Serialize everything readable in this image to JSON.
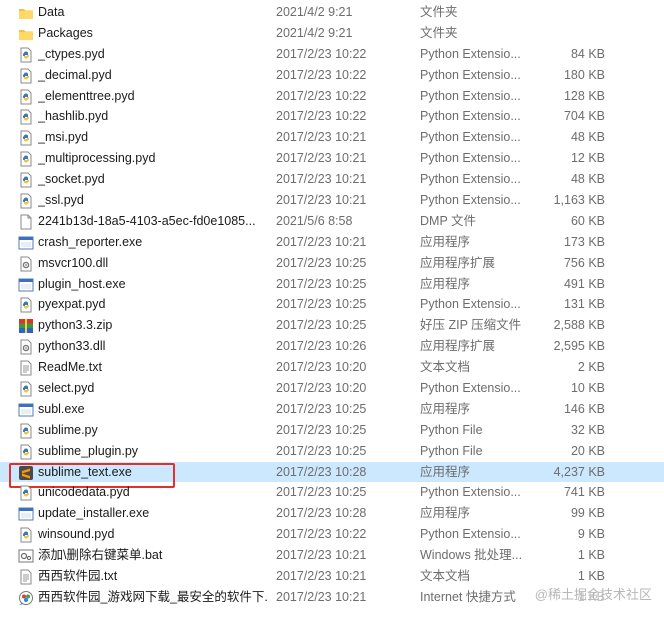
{
  "files": [
    {
      "name": "Data",
      "date": "2021/4/2 9:21",
      "type": "文件夹",
      "size": "",
      "icon": "folder-icon"
    },
    {
      "name": "Packages",
      "date": "2021/4/2 9:21",
      "type": "文件夹",
      "size": "",
      "icon": "folder-icon"
    },
    {
      "name": "_ctypes.pyd",
      "date": "2017/2/23 10:22",
      "type": "Python Extensio...",
      "size": "84 KB",
      "icon": "python-file-icon"
    },
    {
      "name": "_decimal.pyd",
      "date": "2017/2/23 10:22",
      "type": "Python Extensio...",
      "size": "180 KB",
      "icon": "python-file-icon"
    },
    {
      "name": "_elementtree.pyd",
      "date": "2017/2/23 10:22",
      "type": "Python Extensio...",
      "size": "128 KB",
      "icon": "python-file-icon"
    },
    {
      "name": "_hashlib.pyd",
      "date": "2017/2/23 10:22",
      "type": "Python Extensio...",
      "size": "704 KB",
      "icon": "python-file-icon"
    },
    {
      "name": "_msi.pyd",
      "date": "2017/2/23 10:21",
      "type": "Python Extensio...",
      "size": "48 KB",
      "icon": "python-file-icon"
    },
    {
      "name": "_multiprocessing.pyd",
      "date": "2017/2/23 10:21",
      "type": "Python Extensio...",
      "size": "12 KB",
      "icon": "python-file-icon"
    },
    {
      "name": "_socket.pyd",
      "date": "2017/2/23 10:21",
      "type": "Python Extensio...",
      "size": "48 KB",
      "icon": "python-file-icon"
    },
    {
      "name": "_ssl.pyd",
      "date": "2017/2/23 10:21",
      "type": "Python Extensio...",
      "size": "1,163 KB",
      "icon": "python-file-icon"
    },
    {
      "name": "2241b13d-18a5-4103-a5ec-fd0e1085...",
      "date": "2021/5/6 8:58",
      "type": "DMP 文件",
      "size": "60 KB",
      "icon": "blank-file-icon"
    },
    {
      "name": "crash_reporter.exe",
      "date": "2017/2/23 10:21",
      "type": "应用程序",
      "size": "173 KB",
      "icon": "exe-icon"
    },
    {
      "name": "msvcr100.dll",
      "date": "2017/2/23 10:25",
      "type": "应用程序扩展",
      "size": "756 KB",
      "icon": "dll-icon"
    },
    {
      "name": "plugin_host.exe",
      "date": "2017/2/23 10:25",
      "type": "应用程序",
      "size": "491 KB",
      "icon": "exe-icon"
    },
    {
      "name": "pyexpat.pyd",
      "date": "2017/2/23 10:25",
      "type": "Python Extensio...",
      "size": "131 KB",
      "icon": "python-file-icon"
    },
    {
      "name": "python3.3.zip",
      "date": "2017/2/23 10:25",
      "type": "好压 ZIP 压缩文件",
      "size": "2,588 KB",
      "icon": "zip-archive-icon"
    },
    {
      "name": "python33.dll",
      "date": "2017/2/23 10:26",
      "type": "应用程序扩展",
      "size": "2,595 KB",
      "icon": "dll-icon"
    },
    {
      "name": "ReadMe.txt",
      "date": "2017/2/23 10:20",
      "type": "文本文档",
      "size": "2 KB",
      "icon": "text-file-icon"
    },
    {
      "name": "select.pyd",
      "date": "2017/2/23 10:20",
      "type": "Python Extensio...",
      "size": "10 KB",
      "icon": "python-file-icon"
    },
    {
      "name": "subl.exe",
      "date": "2017/2/23 10:25",
      "type": "应用程序",
      "size": "146 KB",
      "icon": "exe-icon"
    },
    {
      "name": "sublime.py",
      "date": "2017/2/23 10:25",
      "type": "Python File",
      "size": "32 KB",
      "icon": "python-file-icon"
    },
    {
      "name": "sublime_plugin.py",
      "date": "2017/2/23 10:25",
      "type": "Python File",
      "size": "20 KB",
      "icon": "python-file-icon"
    },
    {
      "name": "sublime_text.exe",
      "date": "2017/2/23 10:28",
      "type": "应用程序",
      "size": "4,237 KB",
      "icon": "sublime-app-icon",
      "selected": true
    },
    {
      "name": "unicodedata.pyd",
      "date": "2017/2/23 10:25",
      "type": "Python Extensio...",
      "size": "741 KB",
      "icon": "python-file-icon"
    },
    {
      "name": "update_installer.exe",
      "date": "2017/2/23 10:28",
      "type": "应用程序",
      "size": "99 KB",
      "icon": "exe-icon"
    },
    {
      "name": "winsound.pyd",
      "date": "2017/2/23 10:22",
      "type": "Python Extensio...",
      "size": "9 KB",
      "icon": "python-file-icon"
    },
    {
      "name": "添加\\删除右键菜单.bat",
      "date": "2017/2/23 10:21",
      "type": "Windows 批处理...",
      "size": "1 KB",
      "icon": "bat-file-icon"
    },
    {
      "name": "西西软件园.txt",
      "date": "2017/2/23 10:21",
      "type": "文本文档",
      "size": "1 KB",
      "icon": "text-file-icon"
    },
    {
      "name": "西西软件园_游戏网下载_最安全的软件下...",
      "date": "2017/2/23 10:21",
      "type": "Internet 快捷方式",
      "size": "1 KB",
      "icon": "internet-shortcut-icon"
    }
  ],
  "watermark": "@稀土掘金技术社区"
}
